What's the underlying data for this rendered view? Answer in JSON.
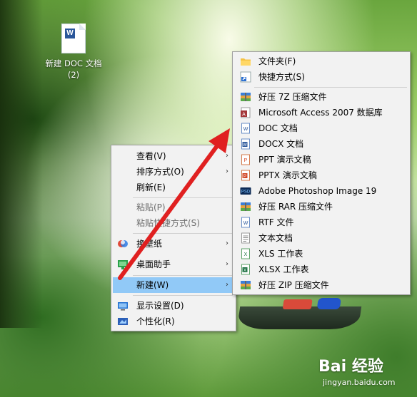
{
  "desktop": {
    "icon": {
      "label": "新建 DOC 文档 (2)",
      "glyph": "W"
    }
  },
  "context_menu": {
    "items": [
      {
        "label": "查看(V)",
        "submenu": true,
        "disabled": false
      },
      {
        "label": "排序方式(O)",
        "submenu": true,
        "disabled": false
      },
      {
        "label": "刷新(E)",
        "submenu": false,
        "disabled": false
      },
      {
        "label": "粘贴(P)",
        "submenu": false,
        "disabled": true
      },
      {
        "label": "粘贴快捷方式(S)",
        "submenu": false,
        "disabled": true
      },
      {
        "label": "换壁纸",
        "icon": "wallpaper-icon",
        "submenu": true
      },
      {
        "label": "桌面助手",
        "icon": "assistant-icon",
        "submenu": true
      },
      {
        "label": "新建(W)",
        "submenu": true,
        "highlighted": true
      },
      {
        "label": "显示设置(D)",
        "icon": "display-icon"
      },
      {
        "label": "个性化(R)",
        "icon": "personalize-icon"
      }
    ],
    "arrow_glyph": "›"
  },
  "new_submenu": {
    "items": [
      {
        "label": "文件夹(F)",
        "icon": "folder-icon"
      },
      {
        "label": "快捷方式(S)",
        "icon": "shortcut-icon"
      },
      {
        "label": "好压 7Z 压缩文件",
        "icon": "archive-icon"
      },
      {
        "label": "Microsoft Access 2007 数据库",
        "icon": "access-icon"
      },
      {
        "label": "DOC 文档",
        "icon": "doc-icon"
      },
      {
        "label": "DOCX 文档",
        "icon": "docx-icon"
      },
      {
        "label": "PPT 演示文稿",
        "icon": "ppt-icon"
      },
      {
        "label": "PPTX 演示文稿",
        "icon": "pptx-icon"
      },
      {
        "label": "Adobe Photoshop Image 19",
        "icon": "psd-icon"
      },
      {
        "label": "好压 RAR 压缩文件",
        "icon": "archive-icon"
      },
      {
        "label": "RTF 文件",
        "icon": "rtf-icon"
      },
      {
        "label": "文本文档",
        "icon": "text-icon"
      },
      {
        "label": "XLS 工作表",
        "icon": "xls-icon"
      },
      {
        "label": "XLSX 工作表",
        "icon": "xlsx-icon"
      },
      {
        "label": "好压 ZIP 压缩文件",
        "icon": "archive-icon"
      }
    ]
  },
  "annotation": {
    "arrow_color": "#e02020"
  },
  "watermark": {
    "brand": "Bai 经验",
    "url": "jingyan.baidu.com"
  },
  "colors": {
    "menu_bg": "#f2f2f2",
    "highlight": "#91c9f7"
  }
}
